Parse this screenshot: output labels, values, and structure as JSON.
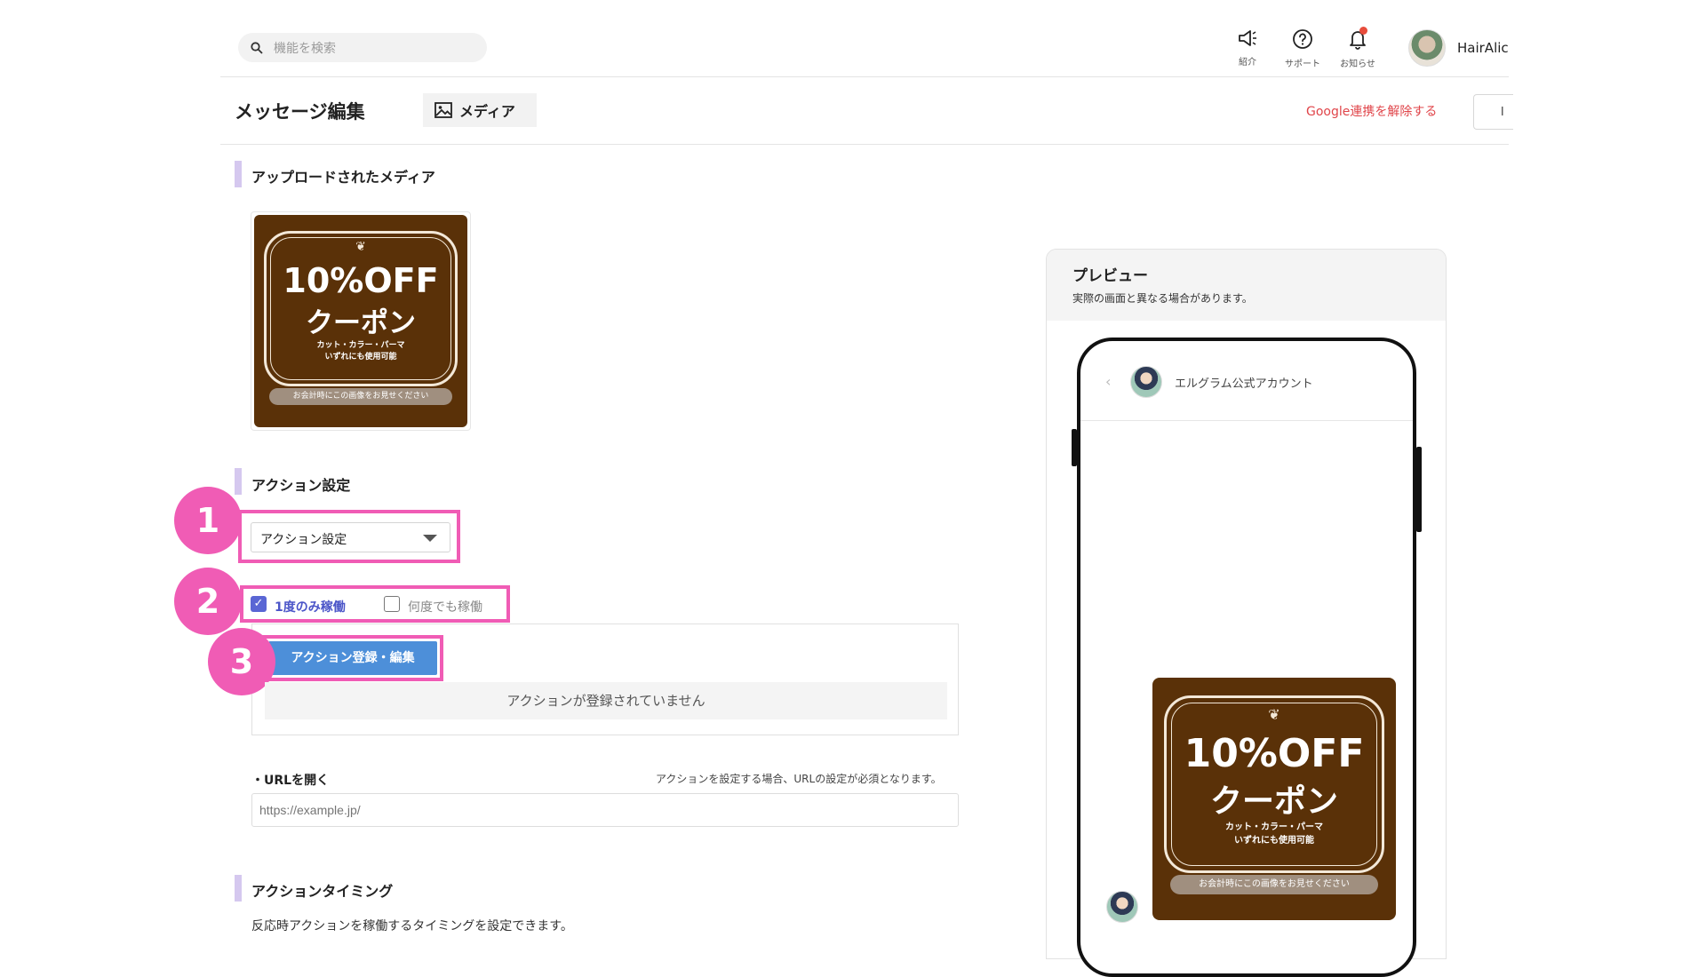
{
  "header": {
    "search_placeholder": "機能を検索",
    "icons": [
      {
        "name": "megaphone-icon",
        "label": "紹介"
      },
      {
        "name": "help-icon",
        "label": "サポート"
      },
      {
        "name": "bell-icon",
        "label": "お知らせ"
      }
    ],
    "username": "HairAlic"
  },
  "titlebar": {
    "title": "メッセージ編集",
    "media_tab": "メディア",
    "google_link": "Google連携を解除する",
    "right_button": "l"
  },
  "uploaded": {
    "section_title": "アップロードされたメディア"
  },
  "coupon": {
    "headline": "10%OFF",
    "subhead": "クーポン",
    "line1": "カット・カラー・パーマ",
    "line2": "いずれにも使用可能",
    "footer": "お会計時にこの画像をお見せください",
    "background": "#5a3108"
  },
  "action": {
    "section_title": "アクション設定",
    "dropdown_value": "アクション設定",
    "once_label": "1度のみ稼働",
    "repeat_label": "何度でも稼働",
    "register_button": "アクション登録・編集",
    "empty_text": "アクションが登録されていません",
    "url_label": "・URLを開く",
    "url_note": "アクションを設定する場合、URLの設定が必須となります。",
    "url_placeholder": "https://example.jp/"
  },
  "timing": {
    "section_title": "アクションタイミング",
    "description": "反応時アクションを稼働するタイミングを設定できます。"
  },
  "steps": [
    "1",
    "2",
    "3"
  ],
  "preview": {
    "title": "プレビュー",
    "subtitle": "実際の画面と異なる場合があります。",
    "account_name": "エルグラム公式アカウント"
  },
  "colors": {
    "highlight": "#f05cb5",
    "accent_button": "#4d8fd9",
    "link_red": "#e0454a",
    "section_bar": "#d5c8ef"
  }
}
